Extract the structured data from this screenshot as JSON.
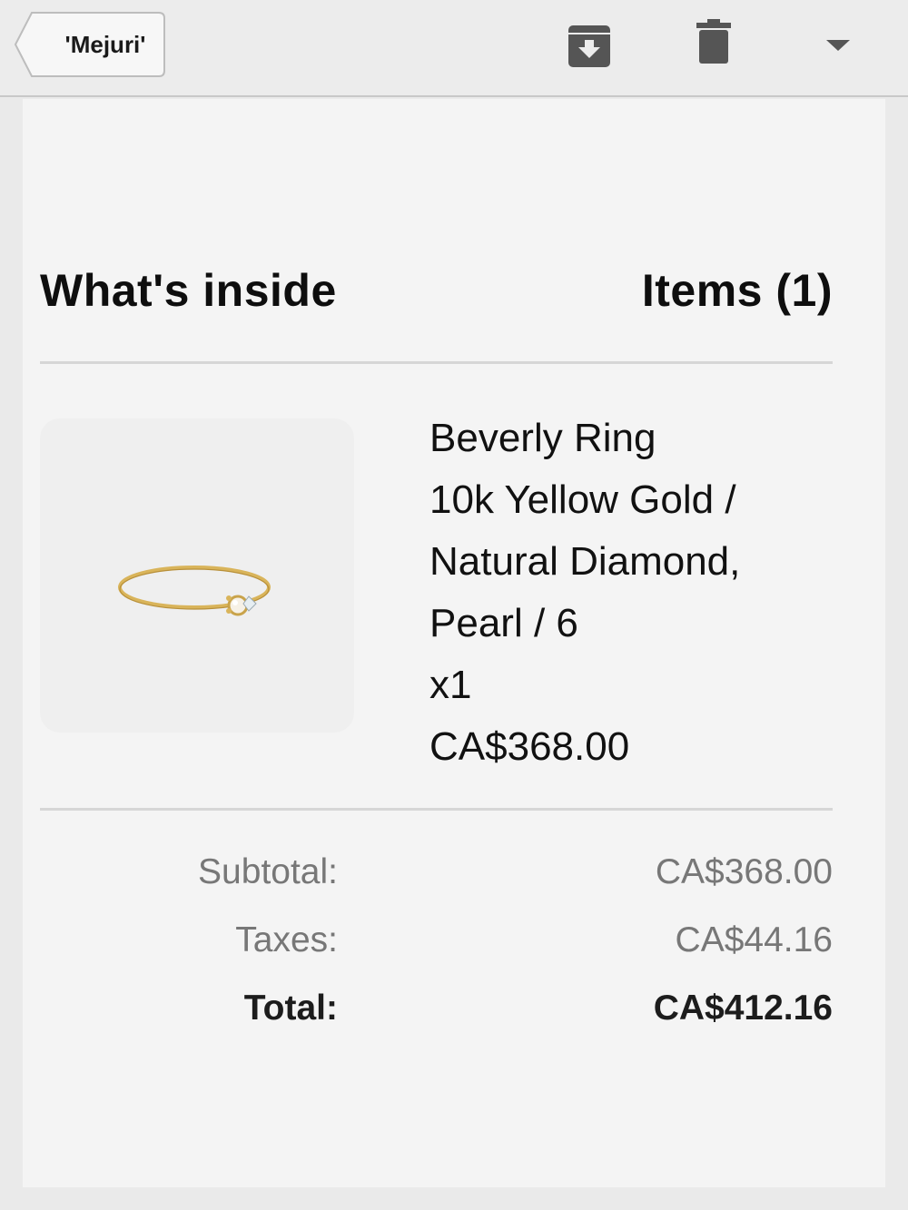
{
  "toolbar": {
    "back_label": "'Mejuri'",
    "icons": [
      "archive-icon",
      "trash-icon",
      "chevron-down-icon"
    ]
  },
  "order": {
    "heading": "What's inside",
    "items_count": "Items (1)",
    "product": {
      "name": "Beverly Ring",
      "variant_line1": "10k Yellow Gold /",
      "variant_line2": "Natural Diamond,",
      "variant_line3": "Pearl / 6",
      "quantity": "x1",
      "price": "CA$368.00"
    },
    "summary": {
      "subtotal_label": "Subtotal:",
      "subtotal_value": "CA$368.00",
      "taxes_label": "Taxes:",
      "taxes_value": "CA$44.16",
      "total_label": "Total:",
      "total_value": "CA$412.16"
    }
  },
  "colors": {
    "toolbar_bg": "#ececec",
    "content_bg": "#f4f4f4",
    "muted_text": "#777777",
    "icon_gray": "#555555",
    "gold": "#d9b45a"
  }
}
